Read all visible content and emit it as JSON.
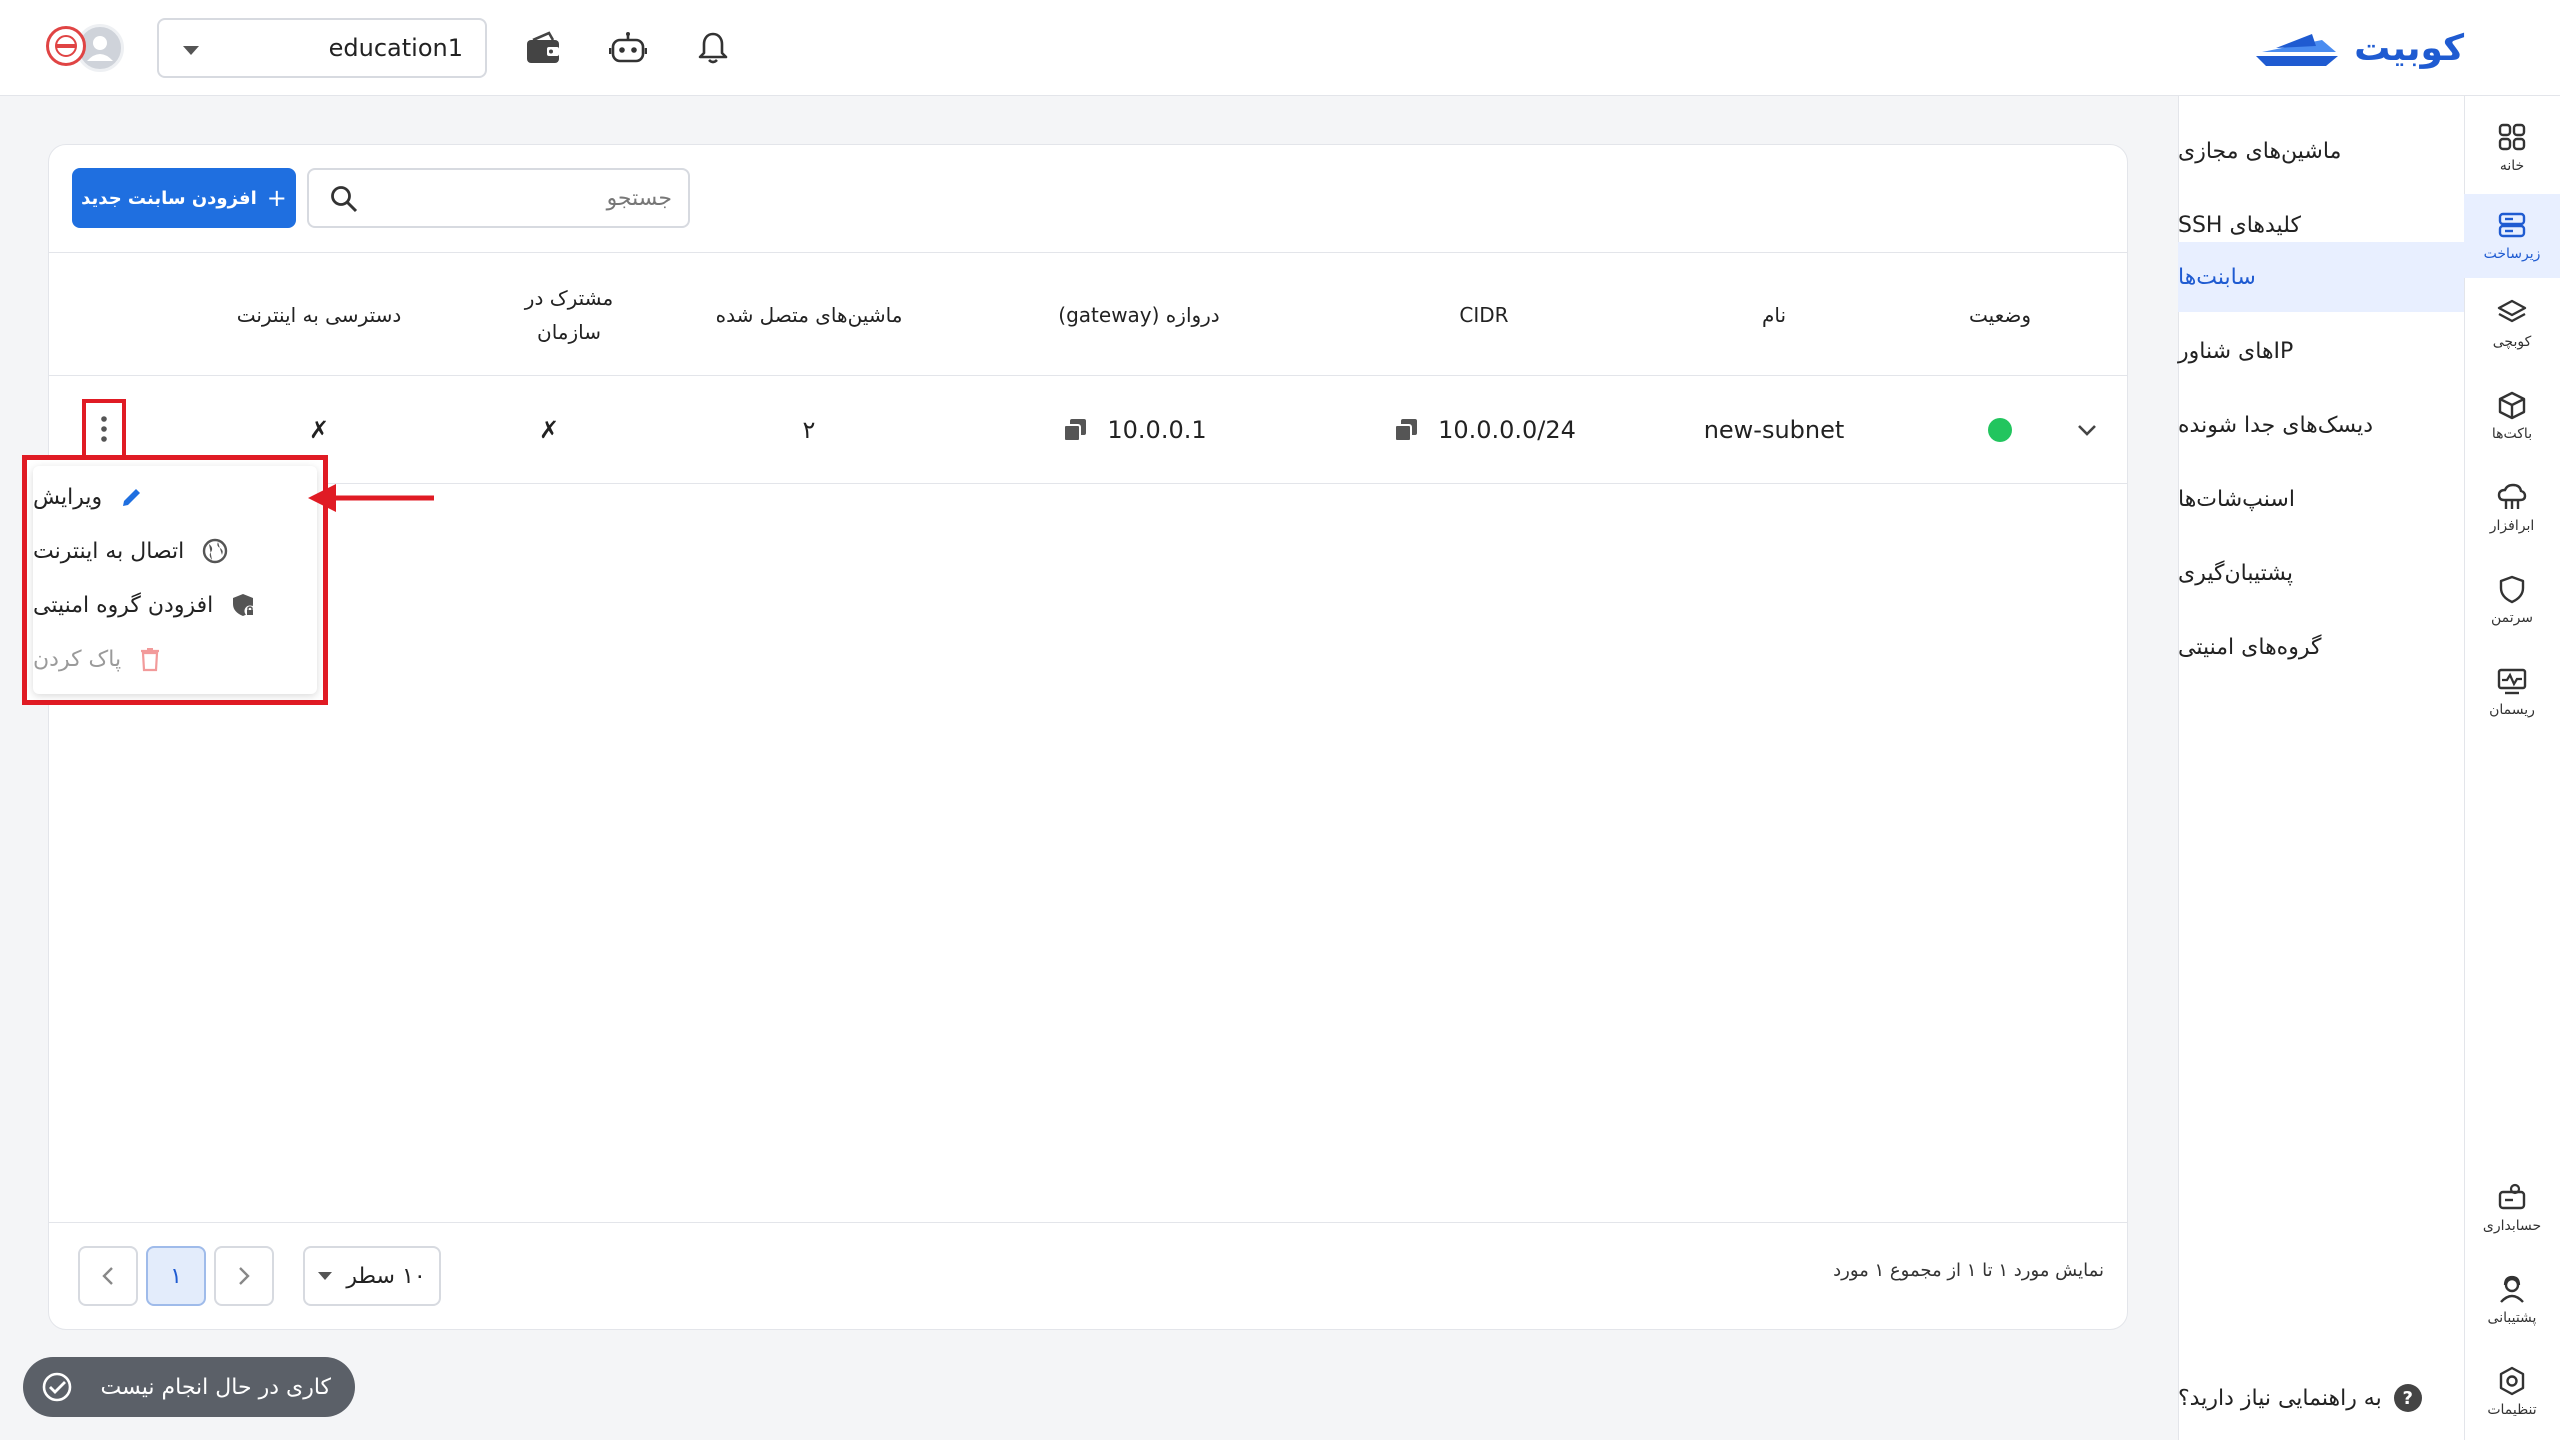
{
  "brand": {
    "name": "کوبیت",
    "color": "#1f5bd1"
  },
  "header": {
    "project": "education1",
    "icons": [
      "wallet-icon",
      "robot-icon",
      "bell-icon",
      "avatar-icon"
    ]
  },
  "rail": {
    "items": [
      {
        "label": "خانه",
        "icon": "grid-icon"
      },
      {
        "label": "زیرساخت",
        "icon": "server-icon",
        "active": true
      },
      {
        "label": "کوبچی",
        "icon": "layers-icon"
      },
      {
        "label": "باکت‌ها",
        "icon": "cube-icon"
      },
      {
        "label": "ابرافزار",
        "icon": "cloud-app-icon"
      },
      {
        "label": "سرتمن",
        "icon": "shield-icon"
      },
      {
        "label": "ریسمان",
        "icon": "monitor-icon"
      },
      {
        "label": "حسابداری",
        "icon": "accounting-icon"
      },
      {
        "label": "پشتیبانی",
        "icon": "support-icon"
      },
      {
        "label": "تنظیمات",
        "icon": "settings-icon"
      }
    ]
  },
  "submenu": {
    "items": [
      {
        "label": "ماشین‌های مجازی"
      },
      {
        "label": "کلیدهای SSH"
      },
      {
        "label": "سابنت‌ها",
        "active": true
      },
      {
        "label": "IPهای شناور"
      },
      {
        "label": "دیسک‌های جدا شونده"
      },
      {
        "label": "اسنپ‌شات‌ها"
      },
      {
        "label": "پشتیبان‌گیری"
      },
      {
        "label": "گروه‌های امنیتی"
      }
    ],
    "help": "به راهنمایی نیاز دارید؟",
    "help_q": "?"
  },
  "toolbar": {
    "add_label": "افزودن سابنت جدید",
    "add_plus": "+",
    "search_placeholder": "جستجو"
  },
  "table": {
    "columns": {
      "status": "وضعیت",
      "name": "نام",
      "cidr": "CIDR",
      "gateway": "دروازه (gateway)",
      "machines": "ماشین‌های متصل شده",
      "shared_1": "مشترک در",
      "shared_2": "سازمان",
      "internet": "دسترسی به اینترنت"
    },
    "rows": [
      {
        "status": "active",
        "name": "new-subnet",
        "cidr": "10.0.0.0/24",
        "gateway": "10.0.0.1",
        "machines": "۲",
        "shared": "✗",
        "internet": "✗"
      }
    ]
  },
  "context_menu": {
    "items": [
      {
        "label": "ویرایش",
        "icon": "pencil-icon"
      },
      {
        "label": "اتصال به اینترنت",
        "icon": "globe-icon"
      },
      {
        "label": "افزودن گروه امنیتی",
        "icon": "shield-lock-icon"
      },
      {
        "label": "پاک کردن",
        "icon": "trash-icon",
        "disabled": true
      }
    ]
  },
  "pagination": {
    "info": "نمایش مورد ۱ تا ۱ از مجموع ۱ مورد",
    "rows_per_page": "۱۰ سطر",
    "current_page": "۱"
  },
  "toast": {
    "text": "کاری در حال انجام نیست"
  },
  "colors": {
    "primary": "#1f6fe0",
    "highlight": "#e01b24",
    "status_ok": "#22c55e"
  }
}
